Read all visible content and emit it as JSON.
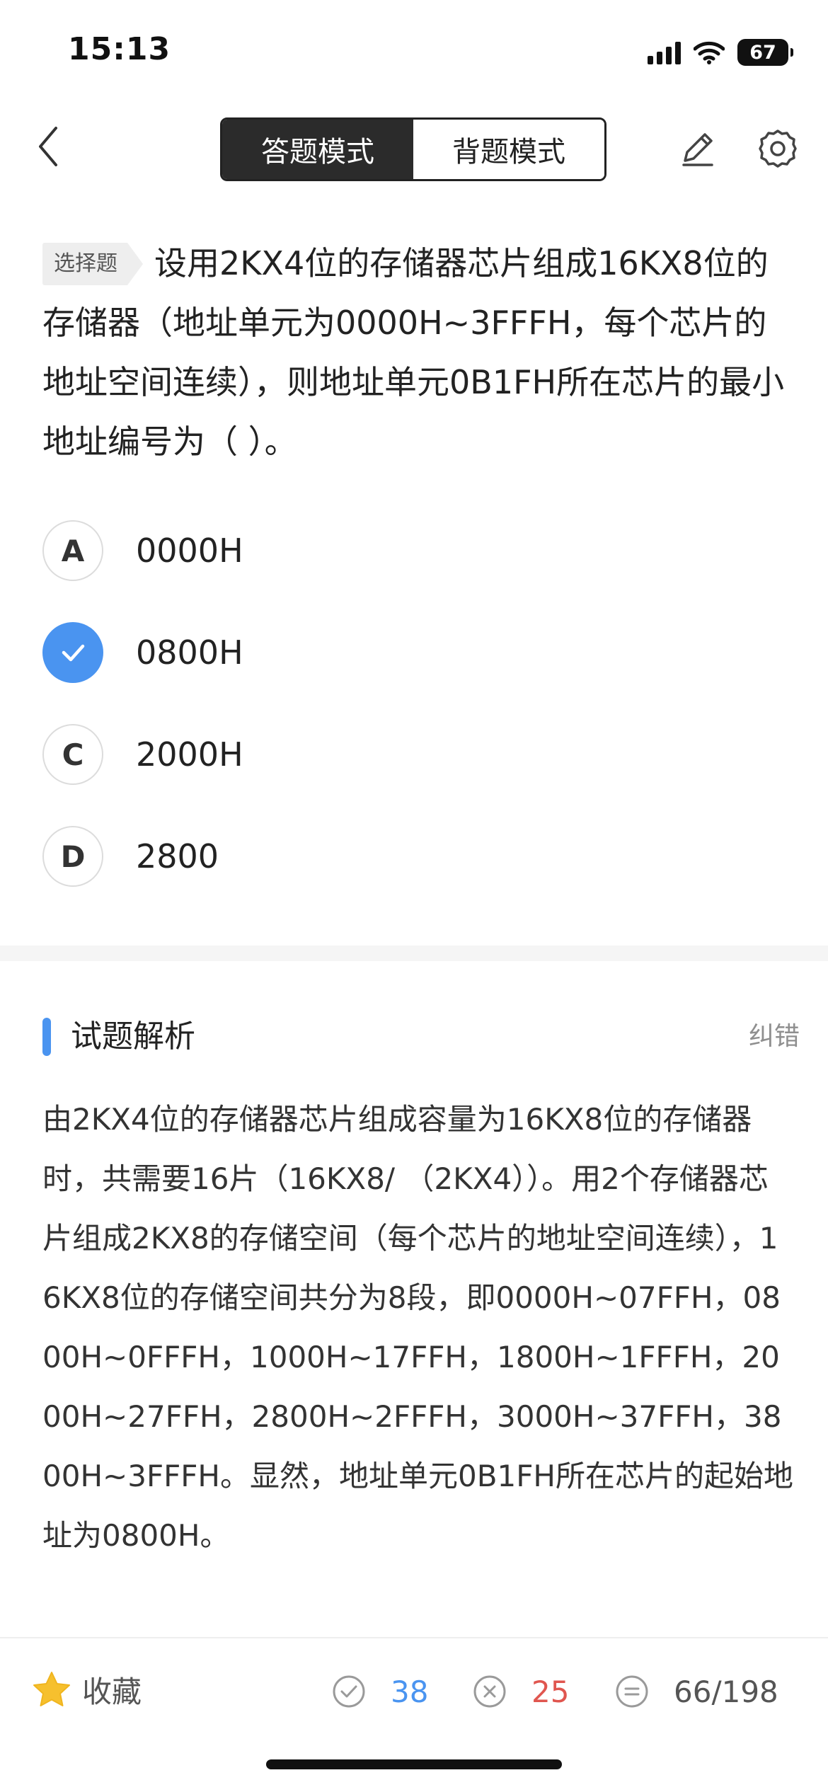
{
  "status_bar": {
    "time": "15:13",
    "battery": "67",
    "icons": [
      "signal-icon",
      "wifi-icon",
      "battery-icon"
    ]
  },
  "nav": {
    "back_icon": "chevron-left-icon",
    "modes": [
      {
        "label": "答题模式",
        "active": true
      },
      {
        "label": "背题模式",
        "active": false
      }
    ],
    "edit_icon": "pencil-icon",
    "settings_icon": "gear-icon"
  },
  "question": {
    "type_tag": "选择题",
    "text": "设用2KX4位的存储器芯片组成16KX8位的存储器（地址单元为0000H~3FFFH，每个芯片的地址空间连续），则地址单元0B1FH所在芯片的最小地址编号为（ ）。"
  },
  "options": [
    {
      "letter": "A",
      "text": "0000H",
      "selected": false
    },
    {
      "letter": "",
      "text": "0800H",
      "selected": true
    },
    {
      "letter": "C",
      "text": "2000H",
      "selected": false
    },
    {
      "letter": "D",
      "text": "2800",
      "selected": false
    }
  ],
  "analysis": {
    "title": "试题解析",
    "report_label": "纠错",
    "accent_color": "#4a94f0",
    "body": "由2KX4位的存储器芯片组成容量为16KX8位的存储器时，共需要16片（16KX8/ （2KX4））。用2个存储器芯片组成2KX8的存储空间（每个芯片的地址空间连续），16KX8位的存储空间共分为8段，即0000H~07FFH，0800H~0FFFH，1000H~17FFH，1800H~1FFFH，2000H~27FFH，2800H~2FFFH，3000H~37FFH，3800H~3FFFH。显然，地址单元0B1FH所在芯片的起始地址为0800H。"
  },
  "bottom_bar": {
    "favorite_label": "收藏",
    "favorite_icon": "star-icon",
    "correct_count": "38",
    "correct_icon": "check-circle-icon",
    "correct_color": "#4a94f0",
    "wrong_count": "25",
    "wrong_icon": "x-circle-icon",
    "wrong_color": "#e0564f",
    "progress": "66/198",
    "progress_icon": "equals-circle-icon"
  }
}
